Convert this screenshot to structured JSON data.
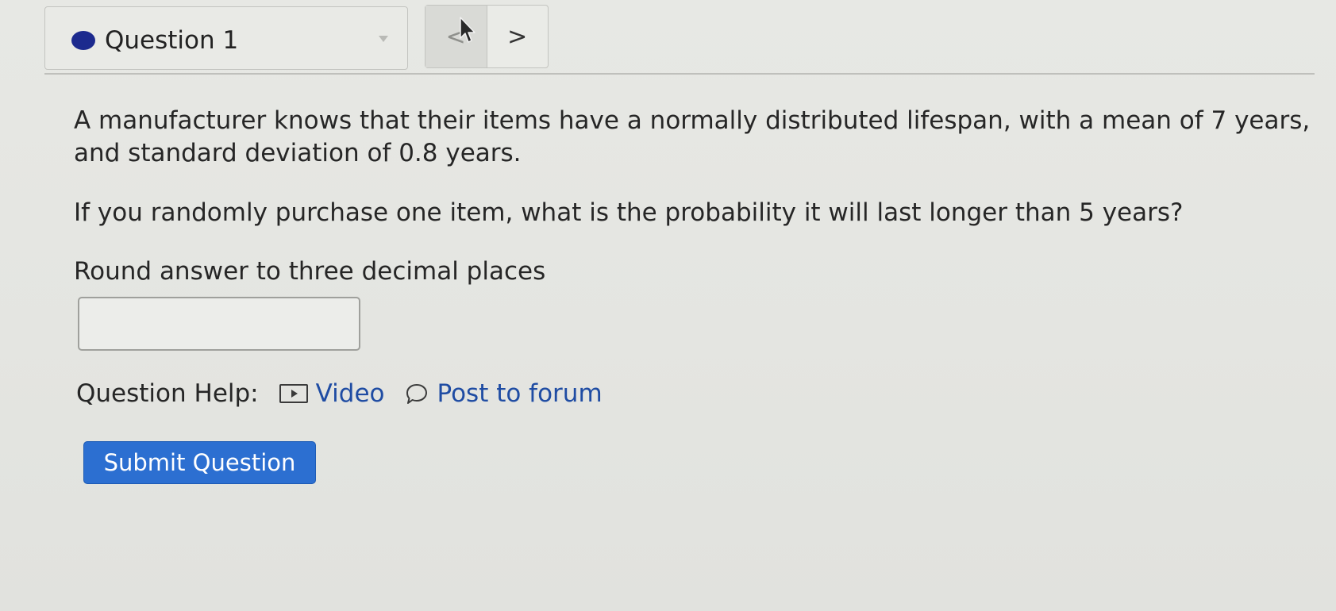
{
  "header": {
    "question_title": "Question 1",
    "prev_symbol": "<",
    "next_symbol": ">"
  },
  "question": {
    "paragraph_1": "A manufacturer knows that their items have a normally distributed lifespan, with a mean of 7 years, and standard deviation of 0.8 years.",
    "paragraph_2": "If you randomly purchase one item, what is the probability it will last longer than 5 years?",
    "paragraph_3": "Round answer to three decimal places"
  },
  "answer": {
    "value": ""
  },
  "help": {
    "label": "Question Help:",
    "video_label": "Video",
    "forum_label": "Post to forum"
  },
  "submit": {
    "label": "Submit Question"
  },
  "colors": {
    "accent": "#2c6fd1",
    "status_dot": "#1c2a8e",
    "link": "#1f4ca3"
  },
  "icons": [
    "status-dot-icon",
    "chevron-left-icon",
    "chevron-right-icon",
    "video-icon",
    "speech-bubble-icon",
    "mouse-cursor-icon"
  ]
}
